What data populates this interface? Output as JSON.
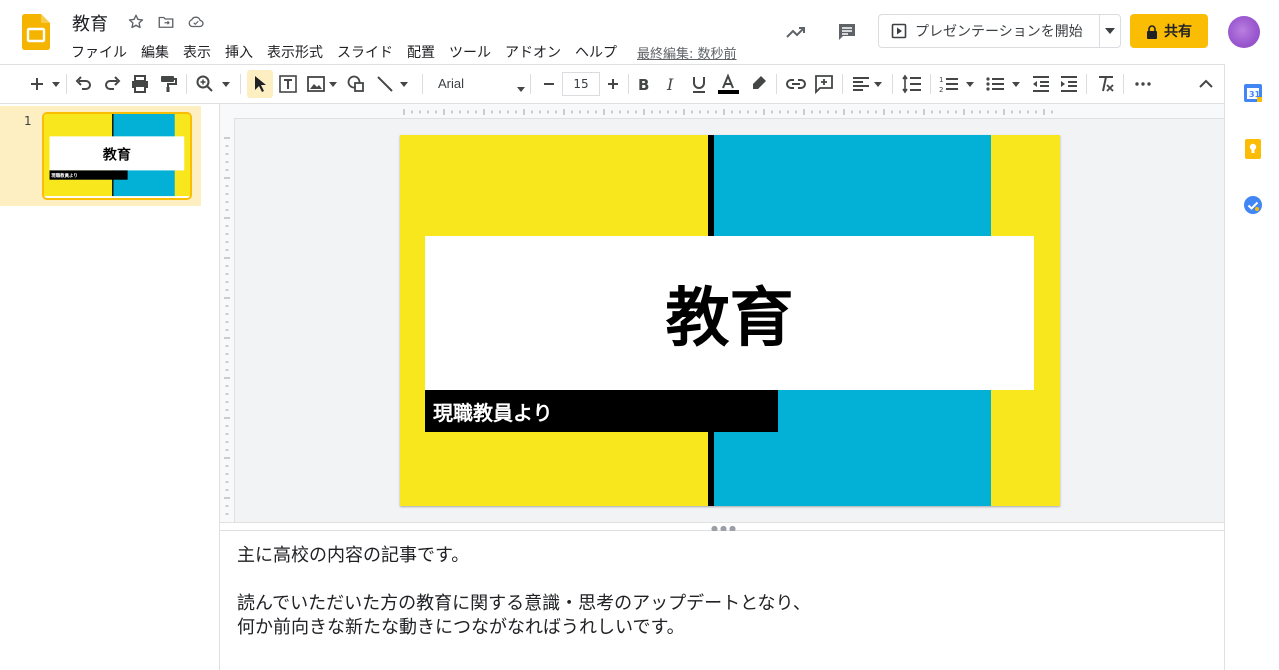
{
  "app": {
    "doc_title": "教育",
    "menu": [
      "ファイル",
      "編集",
      "表示",
      "挿入",
      "表示形式",
      "スライド",
      "配置",
      "ツール",
      "アドオン",
      "ヘルプ"
    ],
    "last_edit": "最終編集: 数秒前",
    "present_label": "プレゼンテーションを開始",
    "share_label": "共有"
  },
  "toolbar": {
    "font_name": "Arial",
    "font_size": "15",
    "text_color": "#000000"
  },
  "filmstrip": {
    "slides": [
      {
        "number": "1",
        "title": "教育",
        "subtitle": "現職教員より"
      }
    ]
  },
  "slide": {
    "title": "教育",
    "subtitle": "現職教員より",
    "colors": {
      "yellow": "#f9e71e",
      "blue": "#03b1d6",
      "black": "#000000",
      "white": "#ffffff"
    }
  },
  "notes": {
    "lines": [
      "主に高校の内容の記事です。",
      "",
      "読んでいただいた方の教育に関する意識・思考のアップデートとなり、",
      "何か前向きな新たな動きにつながなればうれしいです。"
    ]
  },
  "colors": {
    "accent": "#fbbc04",
    "selection": "#feefc3"
  }
}
